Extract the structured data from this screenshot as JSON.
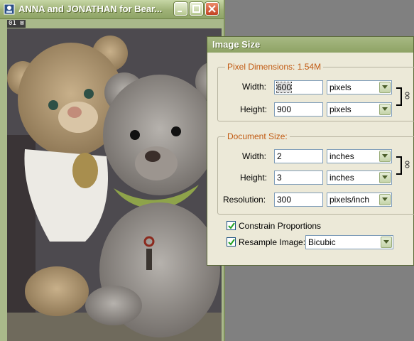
{
  "document_window": {
    "title": "ANNA and JONATHAN for Bear...",
    "status_text": "01",
    "app_icon": "photoshop-icon",
    "buttons": [
      "minimize-icon",
      "maximize-icon",
      "close-icon"
    ]
  },
  "dialog": {
    "title": "Image Size",
    "pixel_dimensions": {
      "legend": "Pixel Dimensions:",
      "size": "1.54M",
      "width_label": "Width:",
      "width_value": "600",
      "width_unit": "pixels",
      "height_label": "Height:",
      "height_value": "900",
      "height_unit": "pixels"
    },
    "document_size": {
      "legend": "Document Size:",
      "width_label": "Width:",
      "width_value": "2",
      "width_unit": "inches",
      "height_label": "Height:",
      "height_value": "3",
      "height_unit": "inches",
      "resolution_label": "Resolution:",
      "resolution_value": "300",
      "resolution_unit": "pixels/inch"
    },
    "constrain_label": "Constrain Proportions",
    "constrain_checked": true,
    "resample_label": "Resample Image:",
    "resample_checked": true,
    "resample_method": "Bicubic"
  },
  "colors": {
    "title_bar": "#9fb277",
    "legend_text": "#c15a12",
    "dialog_bg": "#ece9d8"
  }
}
